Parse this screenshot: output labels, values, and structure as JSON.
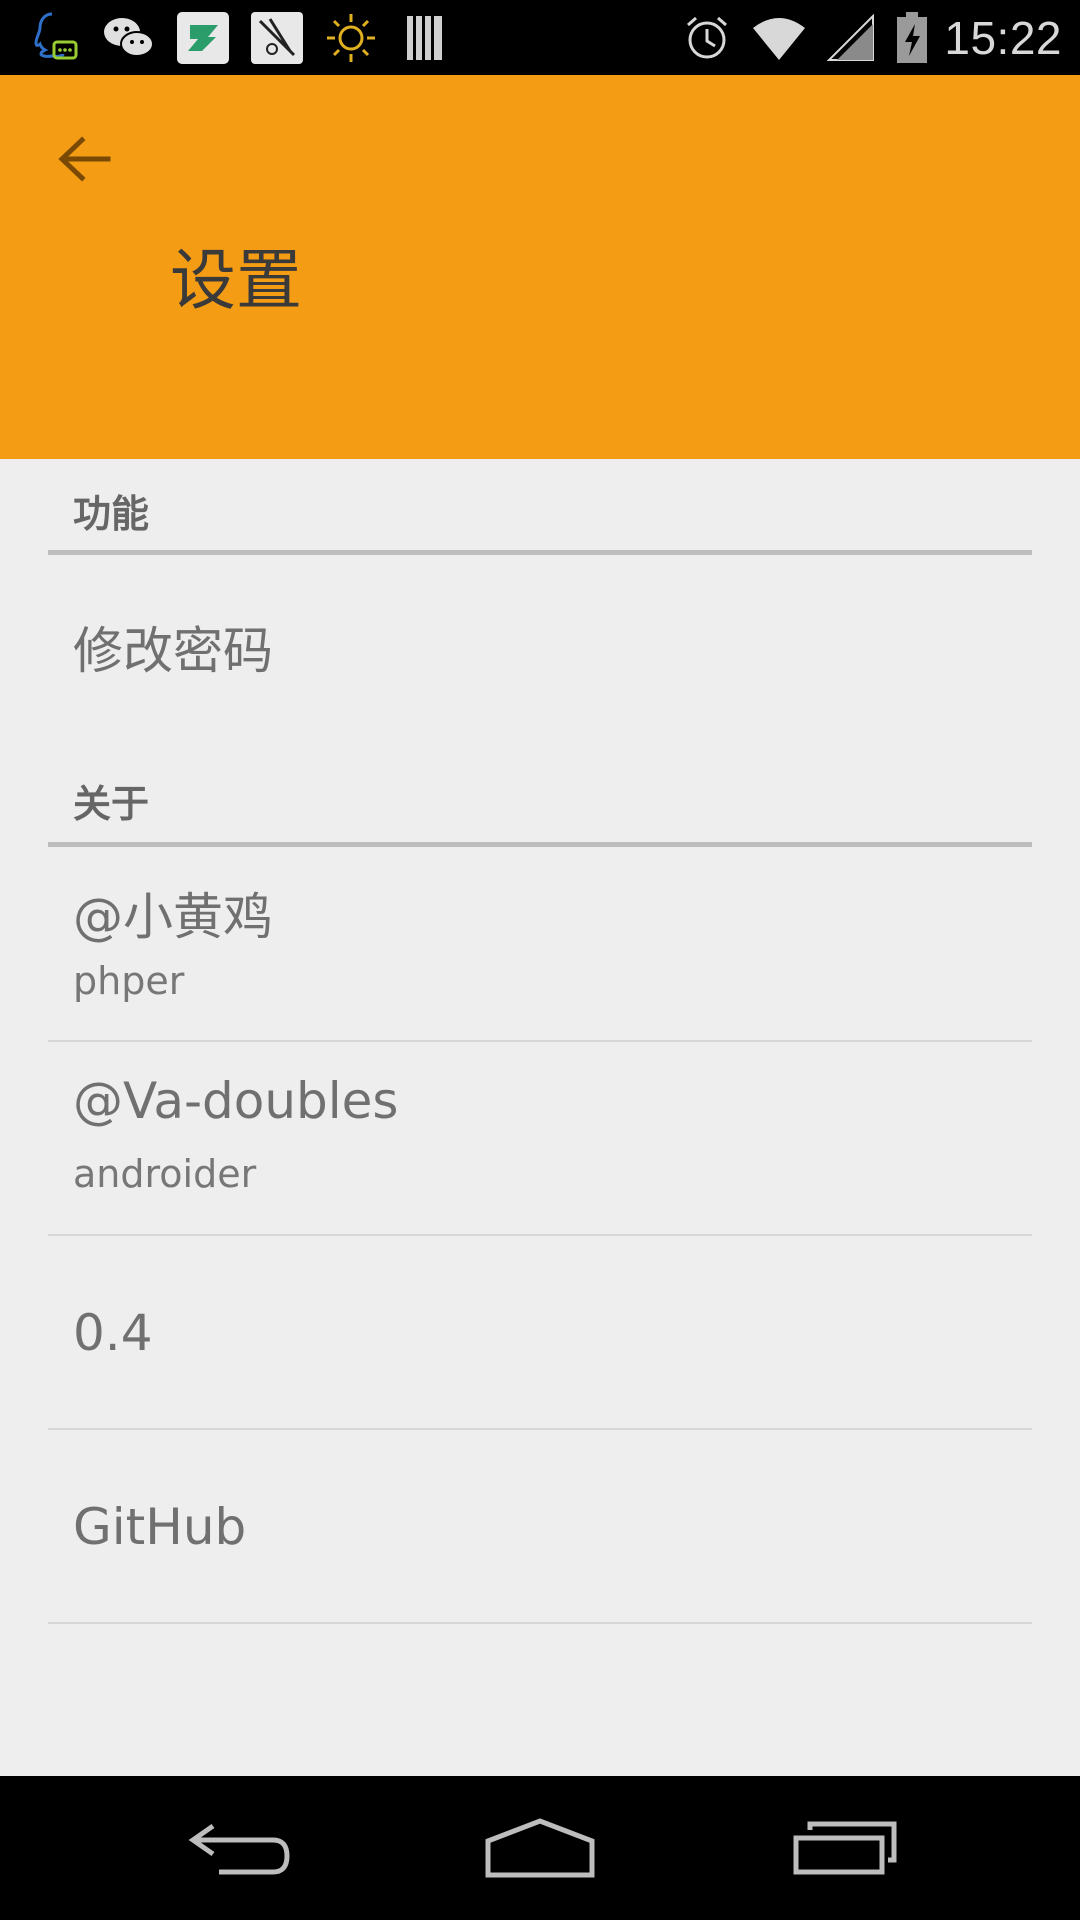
{
  "status_bar": {
    "notification_icons": [
      "qq-icon",
      "wechat-icon",
      "app-z-icon",
      "sketch-app-icon",
      "sun-icon",
      "barcode-icon"
    ],
    "system_icons": [
      "alarm-icon",
      "wifi-icon",
      "signal-icon",
      "battery-charging-icon"
    ],
    "time": "15:22"
  },
  "app_bar": {
    "title": "设置",
    "back_icon": "arrow-back-icon",
    "color": "#f49c14"
  },
  "sections": {
    "function": {
      "header": "功能",
      "items": [
        {
          "title": "修改密码"
        }
      ]
    },
    "about": {
      "header": "关于",
      "items": [
        {
          "title": "@小黄鸡",
          "summary": "phper"
        },
        {
          "title": "@Va-doubles",
          "summary": "androider"
        },
        {
          "title": "0.4"
        },
        {
          "title": "GitHub"
        }
      ]
    }
  },
  "nav_bar": {
    "buttons": [
      "back-nav-icon",
      "home-nav-icon",
      "recents-nav-icon"
    ]
  }
}
